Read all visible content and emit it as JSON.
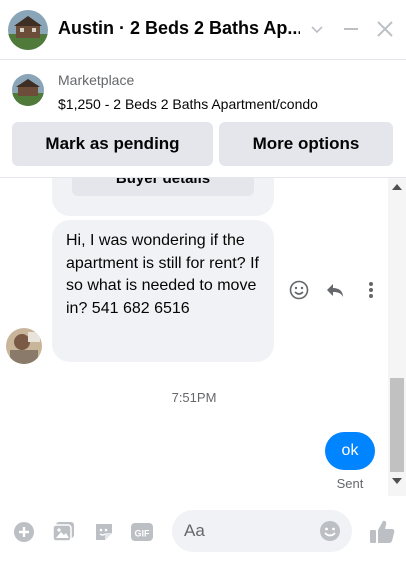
{
  "header": {
    "title": "Austin · 2 Beds 2 Baths Ap...",
    "thumb_icon": "listing-photo",
    "chevron_icon": "chevron-down-icon",
    "minimize_icon": "minimize-icon",
    "close_icon": "close-icon"
  },
  "marketplace": {
    "label": "Marketplace",
    "listing": "$1,250 - 2 Beds 2 Baths Apartment/condo",
    "buttons": {
      "mark_pending": "Mark as pending",
      "more_options": "More options"
    }
  },
  "messages": {
    "previous_card_label": "Buyer details",
    "incoming_text": "Hi, I was wondering if the apartment is still for rent? If so what is needed to move in? 541 682 6516",
    "timestamp": "7:51PM",
    "outgoing_text": "ok",
    "sent_status": "Sent"
  },
  "composer": {
    "placeholder": "Aa",
    "icons": [
      "add-icon",
      "photo-icon",
      "sticker-icon",
      "gif-icon",
      "emoji-icon",
      "like-icon"
    ],
    "gif_label": "GIF"
  },
  "colors": {
    "accent": "#0084ff",
    "icon_gray": "#bcc0c4",
    "bubble_gray": "#f0f2f5"
  }
}
